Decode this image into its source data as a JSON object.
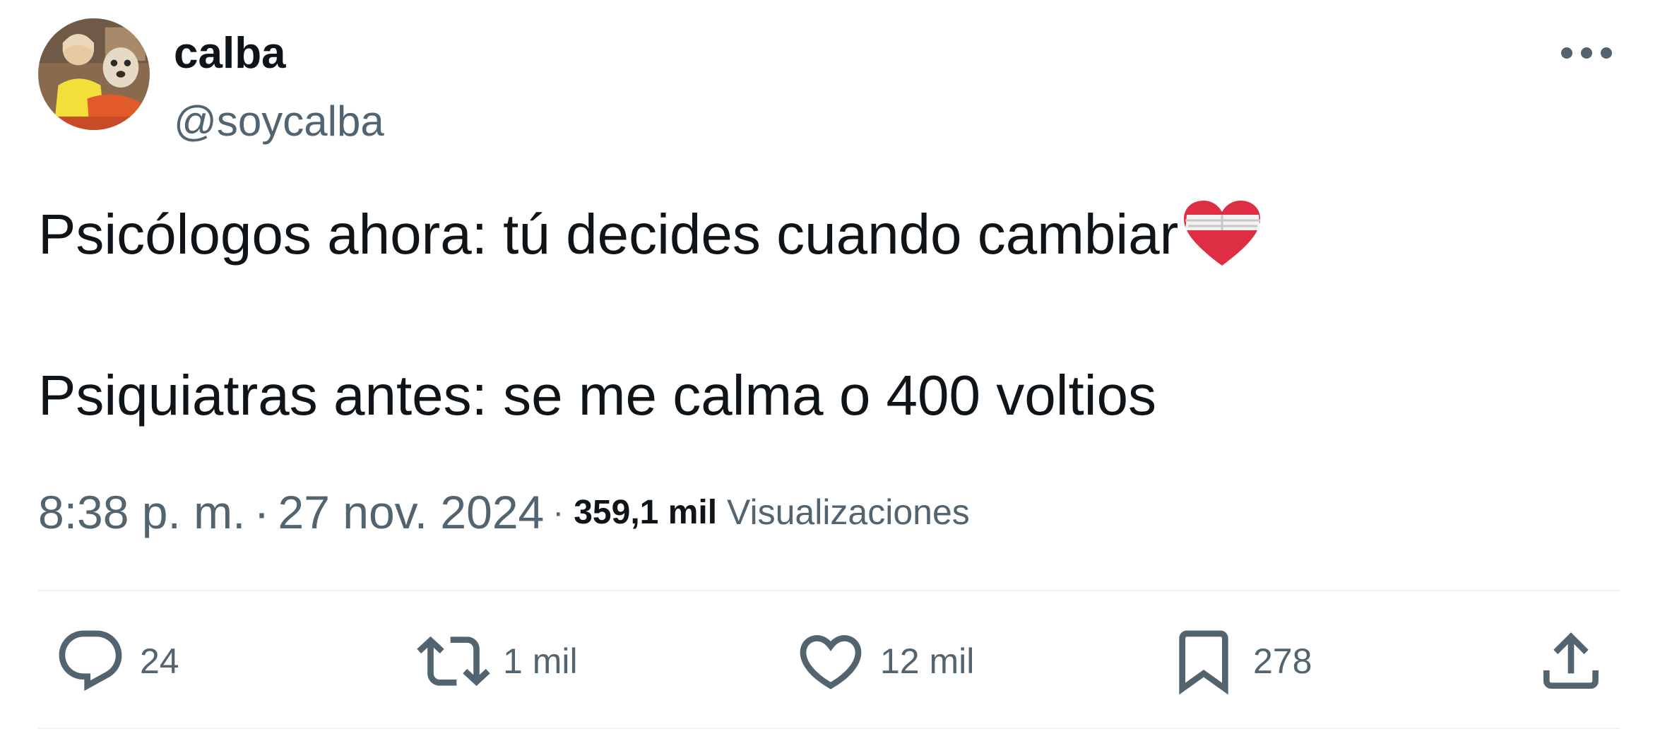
{
  "user": {
    "display_name": "calba",
    "handle": "@soycalba"
  },
  "menu": {
    "icon": "more-horizontal-icon"
  },
  "tweet": {
    "line1": "Psicólogos ahora: tú decides cuando cambiar",
    "line1_emoji": "mending-heart-emoji",
    "line2": "Psiquiatras antes: se me calma o 400 voltios"
  },
  "meta": {
    "time": "8:38 p. m.",
    "separator": "·",
    "date": "27 nov. 2024",
    "views_count": "359,1 mil",
    "views_label": "Visualizaciones"
  },
  "actions": {
    "reply": {
      "icon": "reply-icon",
      "count": "24"
    },
    "retweet": {
      "icon": "retweet-icon",
      "count": "1 mil"
    },
    "like": {
      "icon": "heart-icon",
      "count": "12 mil"
    },
    "bookmark": {
      "icon": "bookmark-icon",
      "count": "278"
    },
    "share": {
      "icon": "share-icon"
    }
  },
  "colors": {
    "text_primary": "#0f1419",
    "text_secondary": "#536471",
    "divider": "#eff3f4"
  }
}
